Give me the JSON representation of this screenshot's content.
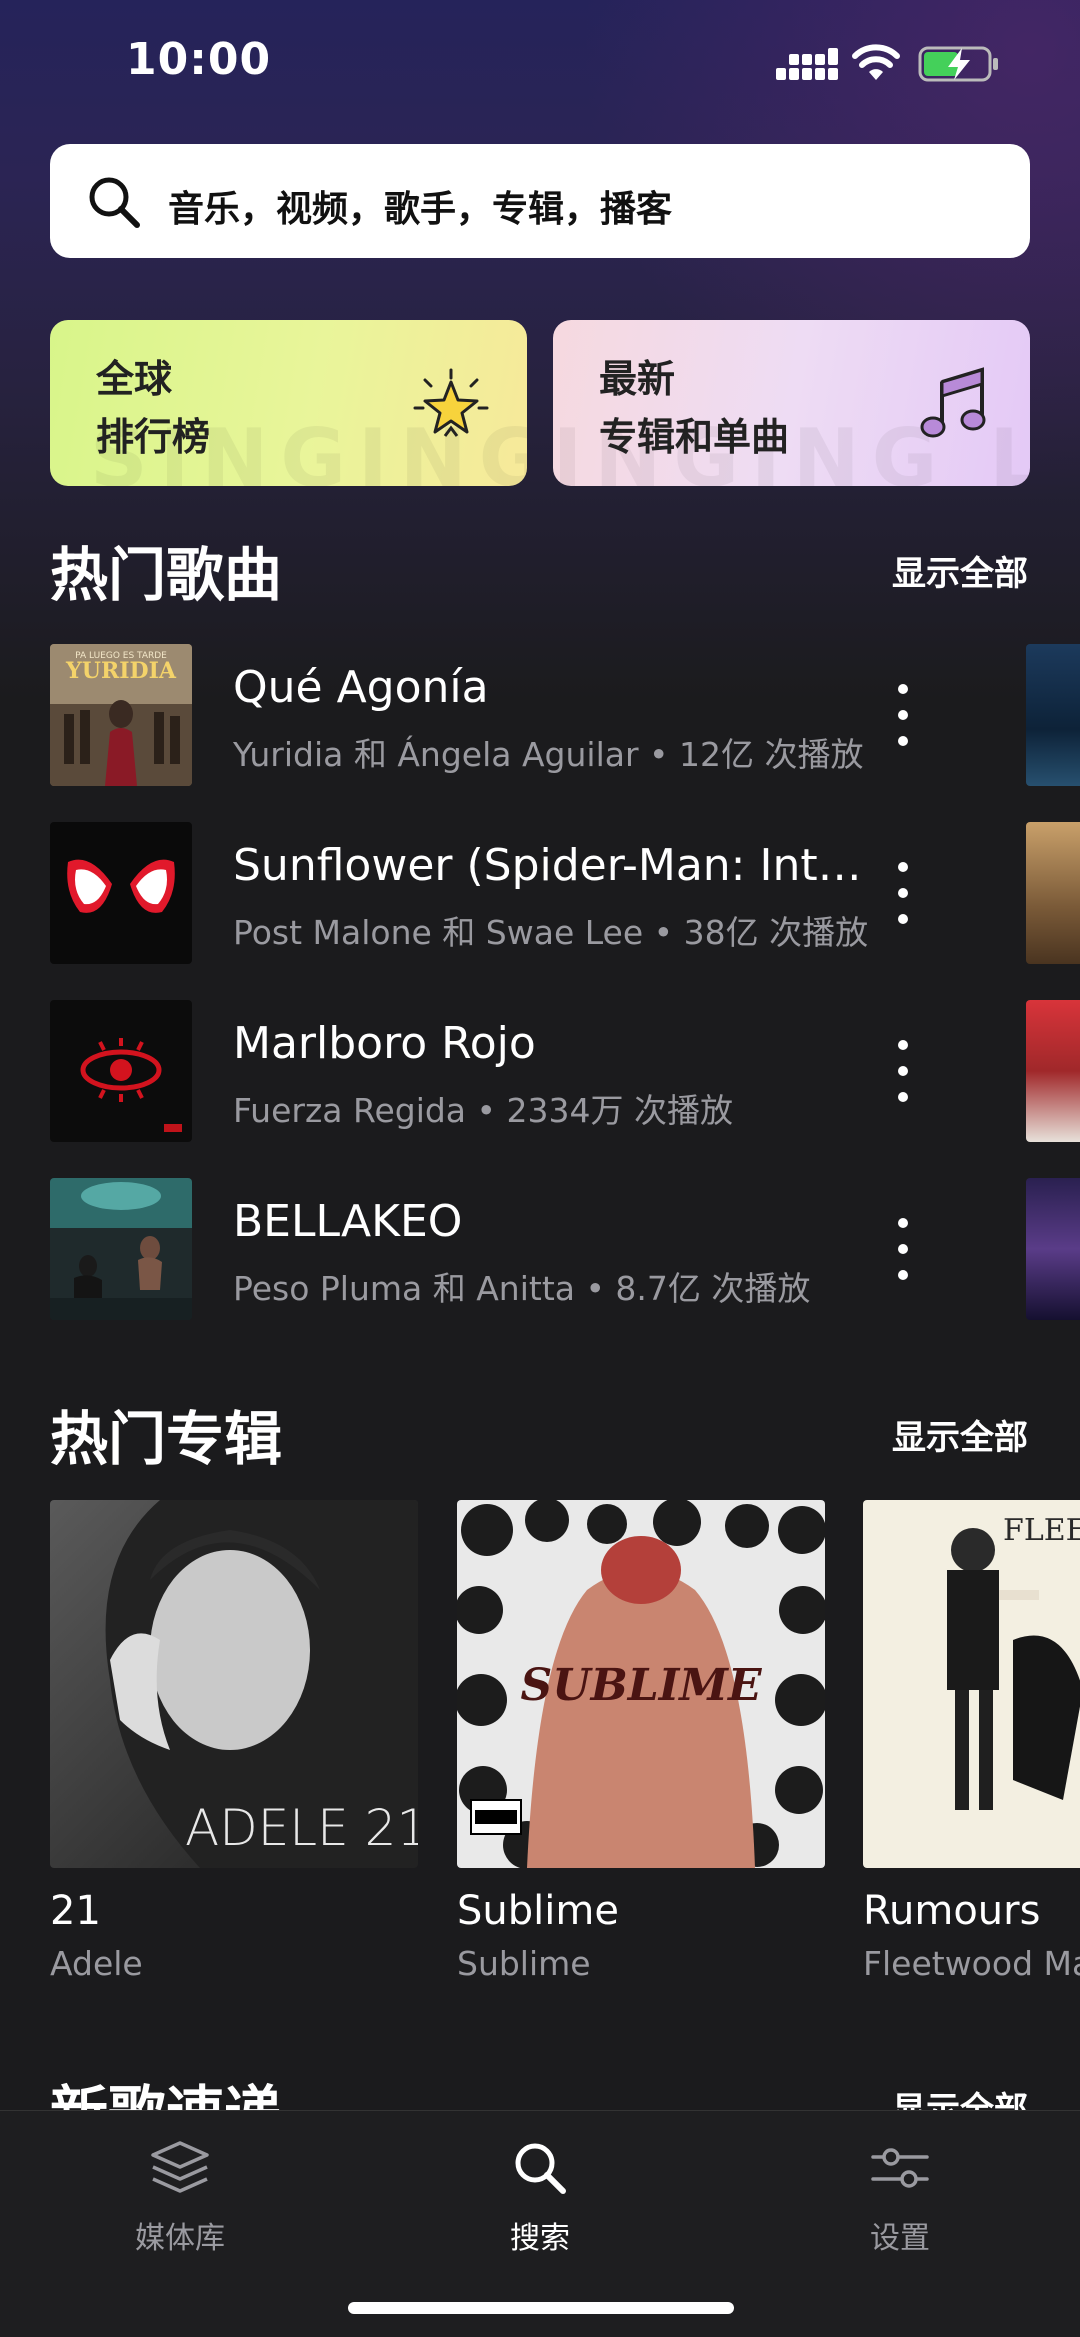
{
  "status_bar": {
    "time": "10:00"
  },
  "search": {
    "placeholder": "音乐，视频，歌手，专辑，播客"
  },
  "categories": [
    {
      "label_line1": "全球",
      "label_line2": "排行榜",
      "icon": "star-icon"
    },
    {
      "label_line1": "最新",
      "label_line2": "专辑和单曲",
      "icon": "music-note-icon"
    }
  ],
  "category_background_text": "SINGING LISTENI",
  "hot_songs": {
    "title": "热门歌曲",
    "show_all": "显示全部",
    "items": [
      {
        "title": "Qué Agonía",
        "meta": "Yuridia 和 Ángela Aguilar • 12亿 次播放",
        "cover_text": "YURIDIA",
        "cover_subtext": "PA LUEGO ES TARDE"
      },
      {
        "title": "Sunflower (Spider-Man: Into the Spider-Verse)",
        "meta": "Post Malone 和 Swae Lee • 38亿 次播放"
      },
      {
        "title": "Marlboro Rojo",
        "meta": "Fuerza Regida • 2334万 次播放"
      },
      {
        "title": "BELLAKEO",
        "meta": "Peso Pluma 和 Anitta • 8.7亿 次播放"
      }
    ]
  },
  "hot_albums": {
    "title": "热门专辑",
    "show_all": "显示全部",
    "items": [
      {
        "title": "21",
        "artist": "Adele",
        "cover_text": "ADELE 21"
      },
      {
        "title": "Sublime",
        "artist": "Sublime",
        "cover_text": "SUBLIME",
        "cover_badge": "PARENTAL ADVISORY EXPLICIT CONTENT"
      },
      {
        "title": "Rumours",
        "artist": "Fleetwood Mac",
        "cover_text": "FLEETWOOD"
      }
    ]
  },
  "new_releases": {
    "title": "新歌速递",
    "show_all": "显示全部"
  },
  "tab_bar": {
    "tabs": [
      {
        "label": "媒体库",
        "icon": "layers-icon",
        "active": false
      },
      {
        "label": "搜索",
        "icon": "search-icon",
        "active": true
      },
      {
        "label": "设置",
        "icon": "sliders-icon",
        "active": false
      }
    ]
  },
  "colors": {
    "background": "#1b1b1d",
    "card_chart": "#d8f58a",
    "card_new": "#e9d6f3",
    "secondary_text": "#9a9aa0"
  }
}
